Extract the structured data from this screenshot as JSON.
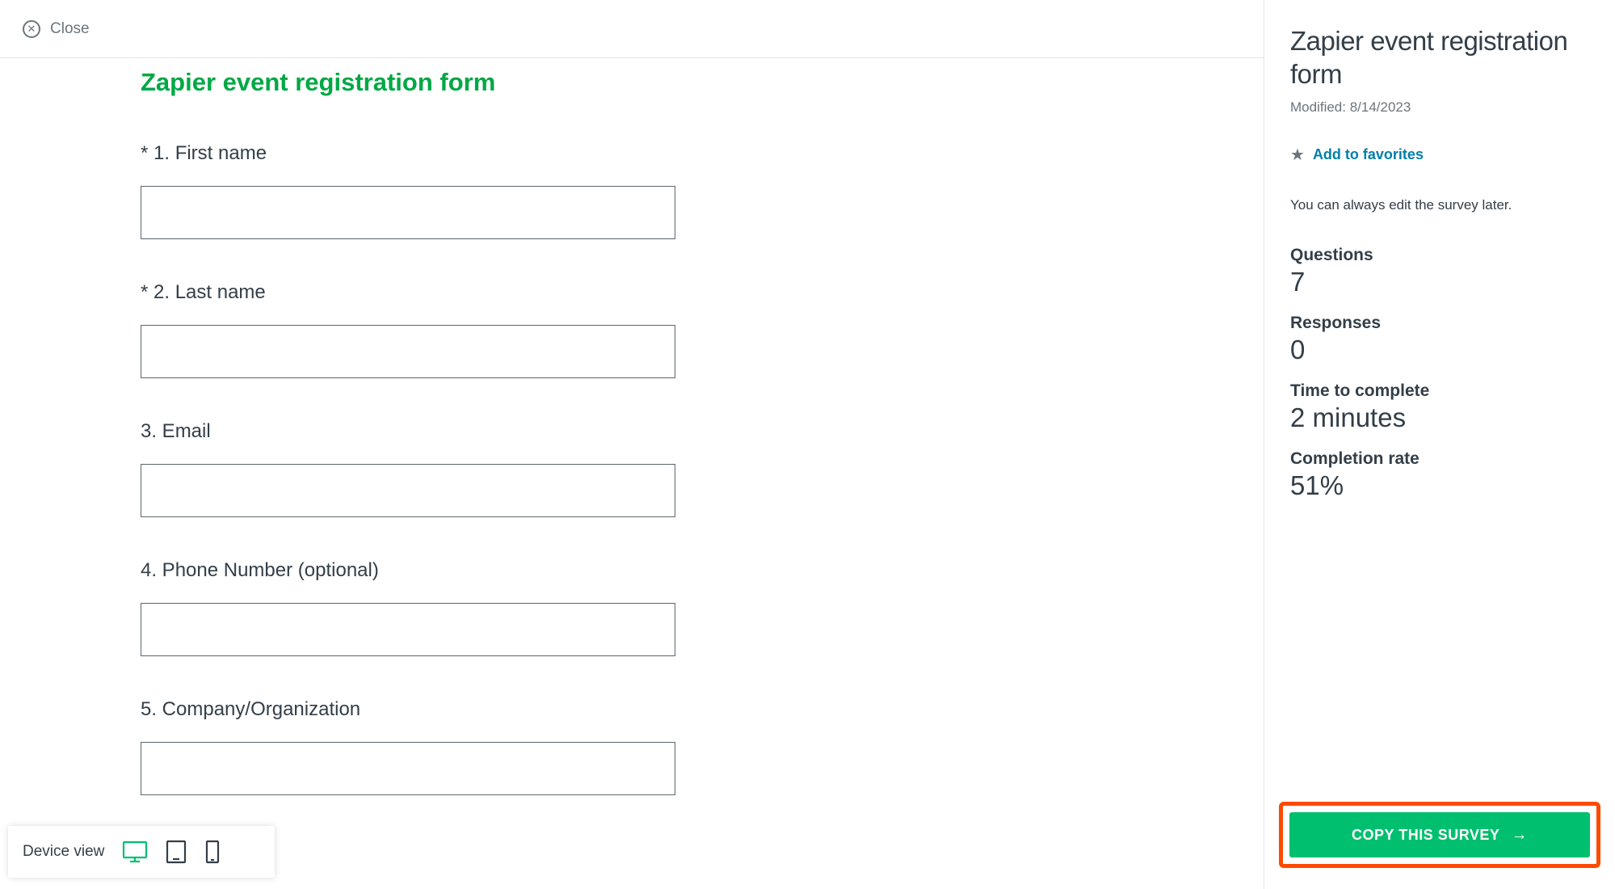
{
  "topbar": {
    "close_label": "Close"
  },
  "form": {
    "title": "Zapier event registration form",
    "questions": [
      {
        "label": "* 1. First name"
      },
      {
        "label": "* 2. Last name"
      },
      {
        "label": "3. Email"
      },
      {
        "label": "4. Phone Number (optional)"
      },
      {
        "label": "5. Company/Organization"
      }
    ]
  },
  "sidebar": {
    "title": "Zapier event registration form",
    "modified": "Modified: 8/14/2023",
    "favorites_label": "Add to favorites",
    "note": "You can always edit the survey later.",
    "stats": {
      "questions_label": "Questions",
      "questions_value": "7",
      "responses_label": "Responses",
      "responses_value": "0",
      "time_label": "Time to complete",
      "time_value": "2 minutes",
      "completion_label": "Completion rate",
      "completion_value": "51%"
    },
    "copy_button": "COPY THIS SURVEY"
  },
  "device_bar": {
    "label": "Device view"
  }
}
